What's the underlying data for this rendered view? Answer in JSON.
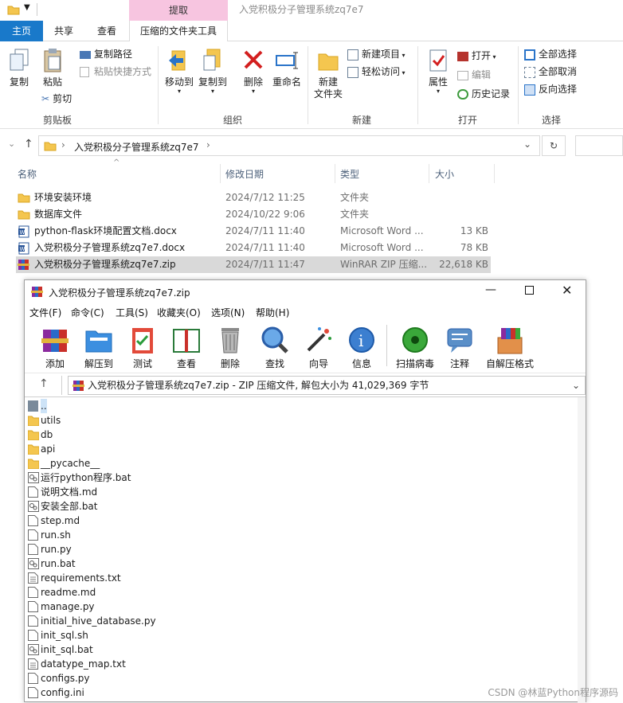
{
  "explorer": {
    "ribbon_context_label": "提取",
    "title": "入党积极分子管理系统zq7e7",
    "tabs": [
      "主页",
      "共享",
      "查看",
      "压缩的文件夹工具"
    ],
    "clipboard": {
      "copy": "复制",
      "paste": "粘贴",
      "copy_path": "复制路径",
      "paste_shortcut": "粘贴快捷方式",
      "cut": "剪切",
      "group": "剪贴板"
    },
    "organize": {
      "move_to": "移动到",
      "copy_to": "复制到",
      "delete": "删除",
      "rename": "重命名",
      "group": "组织"
    },
    "new": {
      "new_folder": "新建\n文件夹",
      "new_item": "新建项目",
      "easy_access": "轻松访问",
      "group": "新建"
    },
    "open": {
      "properties": "属性",
      "open": "打开",
      "edit": "编辑",
      "history": "历史记录",
      "group": "打开"
    },
    "select": {
      "select_all": "全部选择",
      "select_none": "全部取消",
      "invert": "反向选择",
      "group": "选择"
    },
    "address": "入党积极分子管理系统zq7e7",
    "columns": {
      "name": "名称",
      "date": "修改日期",
      "type": "类型",
      "size": "大小"
    },
    "files": [
      {
        "name": "环境安装环境",
        "date": "2024/7/12 11:25",
        "type": "文件夹",
        "size": "",
        "icon": "folder-icon"
      },
      {
        "name": "数据库文件",
        "date": "2024/10/22 9:06",
        "type": "文件夹",
        "size": "",
        "icon": "folder-icon"
      },
      {
        "name": "python-flask环境配置文档.docx",
        "date": "2024/7/11 11:40",
        "type": "Microsoft Word ...",
        "size": "13 KB",
        "icon": "word-icon"
      },
      {
        "name": "入党积极分子管理系统zq7e7.docx",
        "date": "2024/7/11 11:40",
        "type": "Microsoft Word ...",
        "size": "78 KB",
        "icon": "word-icon"
      },
      {
        "name": "入党积极分子管理系统zq7e7.zip",
        "date": "2024/7/11 11:47",
        "type": "WinRAR ZIP 压缩...",
        "size": "22,618 KB",
        "icon": "winrar-icon",
        "selected": true
      }
    ]
  },
  "winrar": {
    "title": "入党积极分子管理系统zq7e7.zip",
    "menu": [
      "文件(F)",
      "命令(C)",
      "工具(S)",
      "收藏夹(O)",
      "选项(N)",
      "帮助(H)"
    ],
    "toolbar": [
      "添加",
      "解压到",
      "测试",
      "查看",
      "删除",
      "查找",
      "向导",
      "信息",
      "扫描病毒",
      "注释",
      "自解压格式"
    ],
    "path": "入党积极分子管理系统zq7e7.zip - ZIP 压缩文件, 解包大小为 41,029,369 字节",
    "entries": [
      {
        "name": "..",
        "icon": "parent-folder-icon"
      },
      {
        "name": "utils",
        "icon": "folder-icon"
      },
      {
        "name": "db",
        "icon": "folder-icon"
      },
      {
        "name": "api",
        "icon": "folder-icon"
      },
      {
        "name": "__pycache__",
        "icon": "folder-icon"
      },
      {
        "name": "运行python程序.bat",
        "icon": "bat-icon"
      },
      {
        "name": "说明文档.md",
        "icon": "file-icon"
      },
      {
        "name": "安装全部.bat",
        "icon": "bat-icon"
      },
      {
        "name": "step.md",
        "icon": "file-icon"
      },
      {
        "name": "run.sh",
        "icon": "file-icon"
      },
      {
        "name": "run.py",
        "icon": "file-icon"
      },
      {
        "name": "run.bat",
        "icon": "bat-icon"
      },
      {
        "name": "requirements.txt",
        "icon": "text-file-icon"
      },
      {
        "name": "readme.md",
        "icon": "file-icon"
      },
      {
        "name": "manage.py",
        "icon": "file-icon"
      },
      {
        "name": "initial_hive_database.py",
        "icon": "file-icon"
      },
      {
        "name": "init_sql.sh",
        "icon": "file-icon"
      },
      {
        "name": "init_sql.bat",
        "icon": "bat-icon"
      },
      {
        "name": "datatype_map.txt",
        "icon": "text-file-icon"
      },
      {
        "name": "configs.py",
        "icon": "file-icon"
      },
      {
        "name": "config.ini",
        "icon": "file-icon"
      }
    ]
  },
  "watermark": "CSDN @林蓝Python程序源码"
}
